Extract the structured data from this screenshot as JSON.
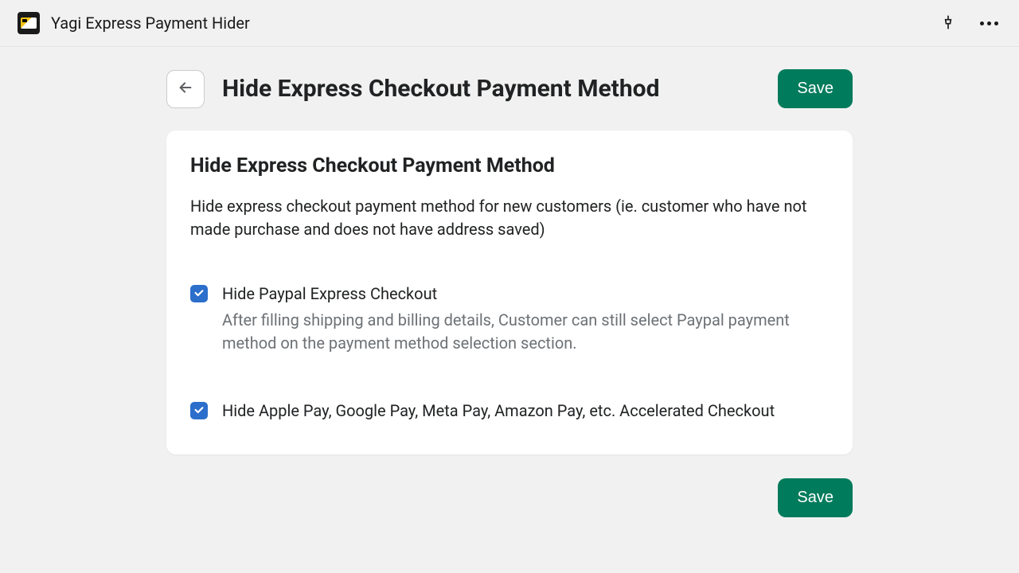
{
  "topbar": {
    "app_name": "Yagi Express Payment Hider"
  },
  "header": {
    "title": "Hide Express Checkout Payment Method",
    "save_label": "Save"
  },
  "card": {
    "title": "Hide Express Checkout Payment Method",
    "description": "Hide express checkout payment method for new customers (ie. customer who have not made purchase and does not have address saved)",
    "options": [
      {
        "label": "Hide Paypal Express Checkout",
        "help": "After filling shipping and billing details, Customer can still select Paypal payment method on the payment method selection section.",
        "checked": true
      },
      {
        "label": "Hide Apple Pay, Google Pay, Meta Pay, Amazon Pay, etc. Accelerated Checkout",
        "help": "",
        "checked": true
      }
    ]
  },
  "footer": {
    "save_label": "Save"
  }
}
